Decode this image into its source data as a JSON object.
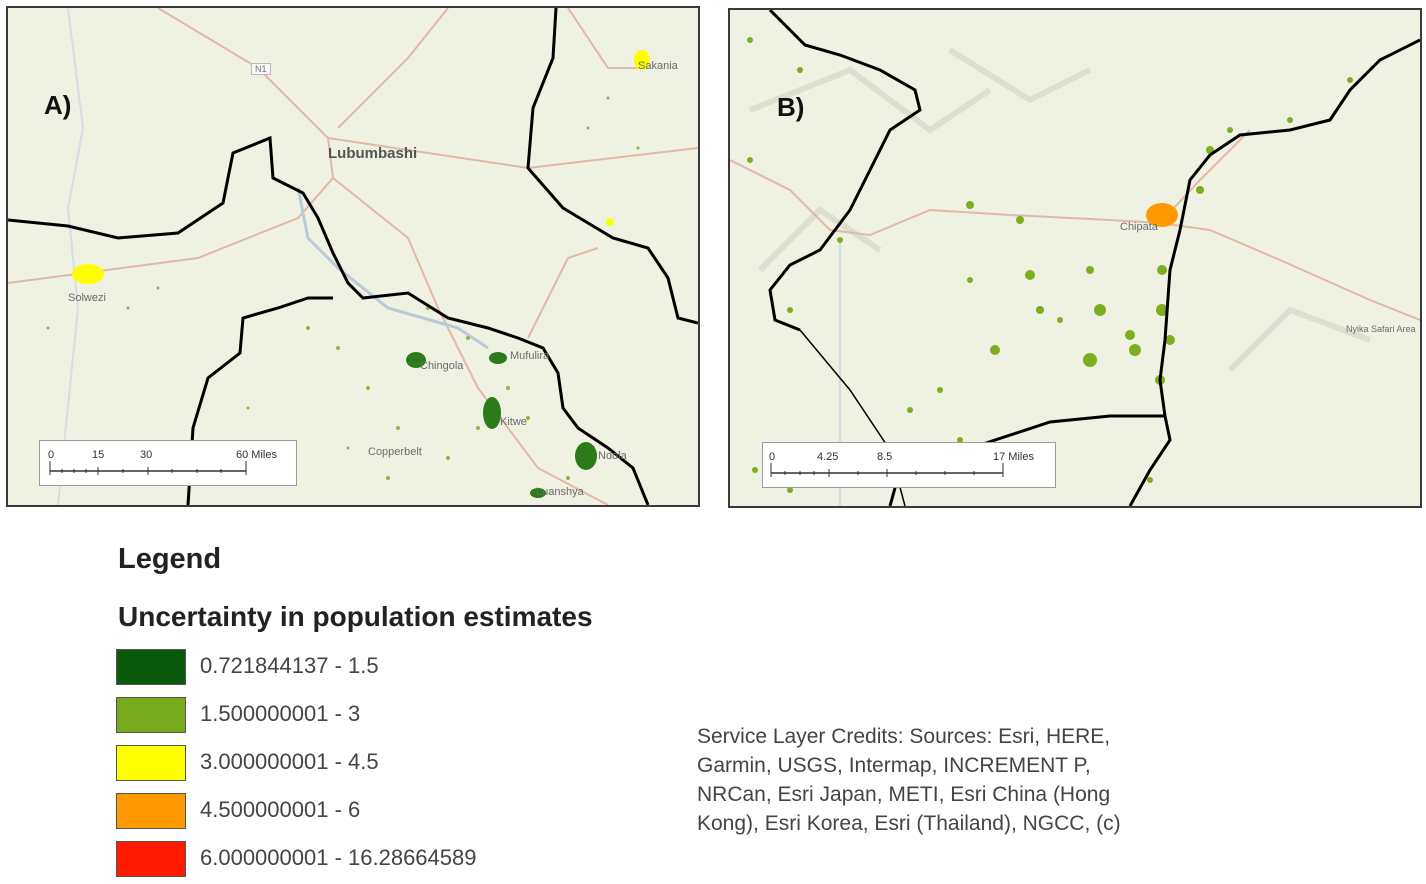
{
  "panels": {
    "a": {
      "label": "A)",
      "places": {
        "lubumbashi": "Lubumbashi",
        "road_badge": "N1",
        "solwezi": "Solwezi",
        "chingola": "Chingola",
        "mufulira": "Mufulira",
        "kitwe": "Kitwe",
        "copperbelt": "Copperbelt",
        "ndola": "Ndola",
        "luanshya": "Luanshya",
        "ne_town": "Sakania"
      },
      "scale_bar": {
        "ticks": [
          "0",
          "15",
          "30",
          "60 Miles"
        ]
      }
    },
    "b": {
      "label": "B)",
      "places": {
        "chipata": "Chipata",
        "reserve": "Nyika Safari Area"
      },
      "scale_bar": {
        "ticks": [
          "0",
          "4.25",
          "8.5",
          "17 Miles"
        ]
      }
    }
  },
  "legend": {
    "title": "Legend",
    "subtitle": "Uncertainty in population estimates",
    "classes": [
      {
        "label": "0.721844137 - 1.5",
        "color": "#0b5a0b"
      },
      {
        "label": "1.500000001 - 3",
        "color": "#78aa1e"
      },
      {
        "label": "3.000000001 - 4.5",
        "color": "#ffff00"
      },
      {
        "label": "4.500000001 - 6",
        "color": "#ff9900"
      },
      {
        "label": "6.000000001 - 16.28664589",
        "color": "#ff1a00"
      }
    ]
  },
  "credits": {
    "lines": [
      "Service Layer Credits: Sources: Esri, HERE,",
      "Garmin, USGS, Intermap, INCREMENT P,",
      "NRCan, Esri Japan, METI, Esri China (Hong",
      "Kong), Esri Korea, Esri (Thailand), NGCC, (c)"
    ]
  },
  "colors": {
    "map_background": "#eff1e2",
    "border_line": "#000000",
    "road": "#e2b7a8",
    "river": "#b9cad8"
  }
}
